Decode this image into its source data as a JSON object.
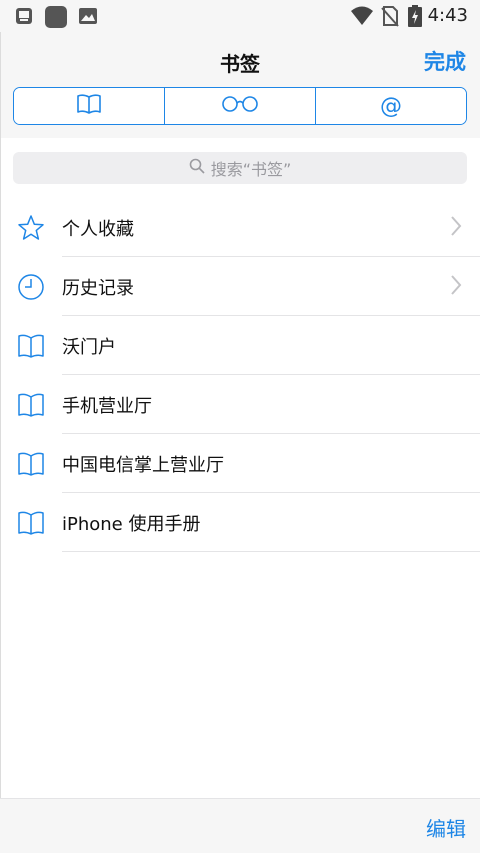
{
  "status_bar": {
    "time": "4:43",
    "icons": [
      "app-notification-icon",
      "square-app-icon",
      "image-icon",
      "wifi-icon",
      "no-sim-icon",
      "battery-charging-icon"
    ]
  },
  "nav": {
    "title": "书签",
    "done_label": "完成"
  },
  "segments": [
    {
      "icon": "book-icon"
    },
    {
      "icon": "glasses-icon"
    },
    {
      "icon": "at-icon",
      "label": "@"
    }
  ],
  "search": {
    "placeholder": "搜索“书签”"
  },
  "bookmarks": [
    {
      "icon": "star-icon",
      "label": "个人收藏",
      "chevron": true
    },
    {
      "icon": "clock-icon",
      "label": "历史记录",
      "chevron": true
    },
    {
      "icon": "book-icon",
      "label": "沃门户",
      "chevron": false
    },
    {
      "icon": "book-icon",
      "label": "手机营业厅",
      "chevron": false
    },
    {
      "icon": "book-icon",
      "label": "中国电信掌上营业厅",
      "chevron": false
    },
    {
      "icon": "book-icon",
      "label": "iPhone 使用手册",
      "chevron": false
    }
  ],
  "toolbar": {
    "edit_label": "编辑"
  },
  "colors": {
    "accent": "#1e86e6",
    "bar_background": "#f6f6f6"
  }
}
